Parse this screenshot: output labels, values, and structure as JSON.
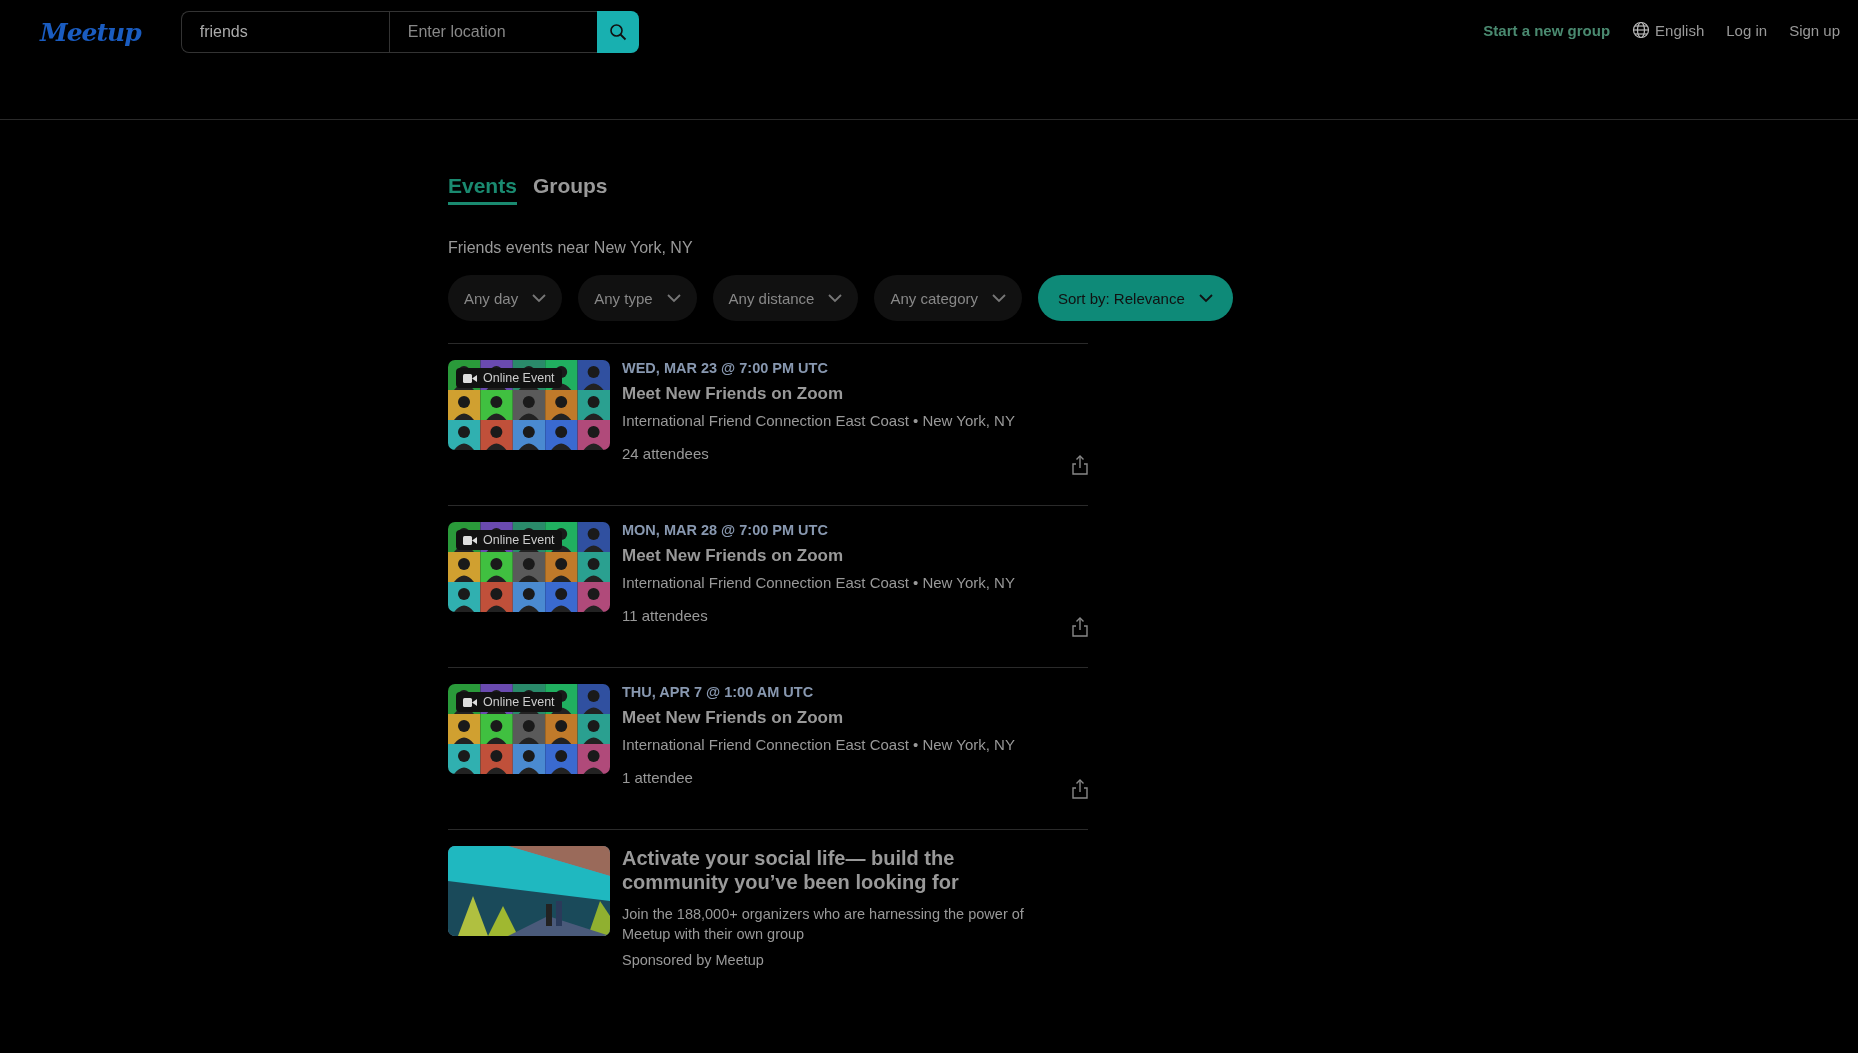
{
  "header": {
    "logo": "Meetup",
    "search": {
      "value": "friends",
      "location_placeholder": "Enter location"
    },
    "links": [
      {
        "label": "Start a new group",
        "kind": "accent"
      },
      {
        "label": "English",
        "kind": "language"
      },
      {
        "label": "Log in",
        "kind": "plain"
      },
      {
        "label": "Sign up",
        "kind": "plain"
      }
    ]
  },
  "tabs": [
    {
      "label": "Events",
      "selected": true
    },
    {
      "label": "Groups",
      "selected": false
    }
  ],
  "subtitle": "Friends events near New York, NY",
  "filters": [
    {
      "label": "Any day",
      "selected": false
    },
    {
      "label": "Any type",
      "selected": false
    },
    {
      "label": "Any distance",
      "selected": false
    },
    {
      "label": "Any category",
      "selected": false
    },
    {
      "label": "Sort by: Relevance",
      "selected": true
    }
  ],
  "events": [
    {
      "badge": "Online Event",
      "date": "WED, MAR 23 @ 7:00 PM UTC",
      "title": "Meet New Friends on Zoom",
      "group": "International Friend Connection East Coast • New York, NY",
      "attendees": "24 attendees"
    },
    {
      "badge": "Online Event",
      "date": "MON, MAR 28 @ 7:00 PM UTC",
      "title": "Meet New Friends on Zoom",
      "group": "International Friend Connection East Coast • New York, NY",
      "attendees": "11 attendees"
    },
    {
      "badge": "Online Event",
      "date": "THU, APR 7 @ 1:00 AM UTC",
      "title": "Meet New Friends on Zoom",
      "group": "International Friend Connection East Coast • New York, NY",
      "attendees": "1 attendee"
    }
  ],
  "promo": {
    "title": "Activate your social life— build the community you’ve been looking for",
    "text": "Join the 188,000+ organizers who are harnessing the power of Meetup with their own group",
    "sponsor": "Sponsored by Meetup"
  }
}
